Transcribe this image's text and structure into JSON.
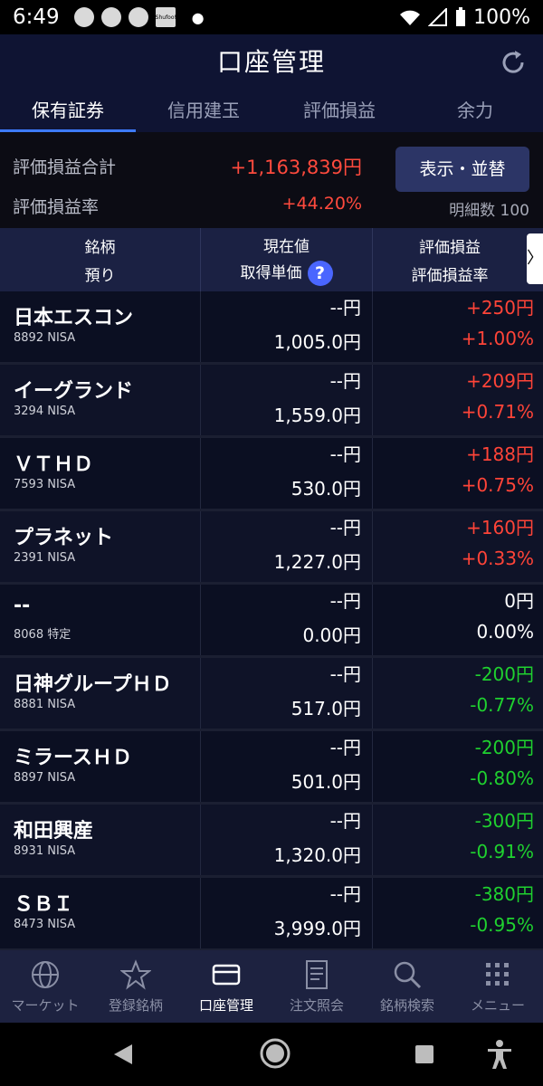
{
  "status": {
    "time": "6:49",
    "battery": "100%",
    "notif_box_text": "Shufoo!"
  },
  "header": {
    "title": "口座管理"
  },
  "tabs": [
    "保有証券",
    "信用建玉",
    "評価損益",
    "余力"
  ],
  "summary": {
    "total_label": "評価損益合計",
    "total_value": "+1,163,839円",
    "rate_label": "評価損益率",
    "rate_value": "+44.20%",
    "display_button": "表示・並替",
    "detail_count": "明細数 100"
  },
  "table_header": {
    "col1_top": "銘柄",
    "col1_bottom": "預り",
    "col2_top": "現在値",
    "col2_bottom": "取得単価",
    "col3_top": "評価損益",
    "col3_bottom": "評価損益率",
    "help": "?",
    "arrow": "〉"
  },
  "rows": [
    {
      "name": "日本エスコン",
      "code": "8892 NISA",
      "current": "--円",
      "cost": "1,005.0円",
      "pl": "+250円",
      "rate": "+1.00%",
      "sign": "pos"
    },
    {
      "name": "イーグランド",
      "code": "3294 NISA",
      "current": "--円",
      "cost": "1,559.0円",
      "pl": "+209円",
      "rate": "+0.71%",
      "sign": "pos"
    },
    {
      "name": "ＶＴＨＤ",
      "code": "7593 NISA",
      "current": "--円",
      "cost": "530.0円",
      "pl": "+188円",
      "rate": "+0.75%",
      "sign": "pos"
    },
    {
      "name": "プラネット",
      "code": "2391 NISA",
      "current": "--円",
      "cost": "1,227.0円",
      "pl": "+160円",
      "rate": "+0.33%",
      "sign": "pos"
    },
    {
      "name": "--",
      "code": "8068 特定",
      "current": "--円",
      "cost": "0.00円",
      "pl": "0円",
      "rate": "0.00%",
      "sign": "neu"
    },
    {
      "name": "日神グループＨＤ",
      "code": "8881 NISA",
      "current": "--円",
      "cost": "517.0円",
      "pl": "-200円",
      "rate": "-0.77%",
      "sign": "neg"
    },
    {
      "name": "ミラースＨＤ",
      "code": "8897 NISA",
      "current": "--円",
      "cost": "501.0円",
      "pl": "-200円",
      "rate": "-0.80%",
      "sign": "neg"
    },
    {
      "name": "和田興産",
      "code": "8931 NISA",
      "current": "--円",
      "cost": "1,320.0円",
      "pl": "-300円",
      "rate": "-0.91%",
      "sign": "neg"
    },
    {
      "name": "ＳＢＩ",
      "code": "8473 NISA",
      "current": "--円",
      "cost": "3,999.0円",
      "pl": "-380円",
      "rate": "-0.95%",
      "sign": "neg"
    }
  ],
  "bottom_nav": [
    {
      "label": "マーケット",
      "icon": "globe-icon"
    },
    {
      "label": "登録銘柄",
      "icon": "star-icon"
    },
    {
      "label": "口座管理",
      "icon": "card-icon",
      "active": true
    },
    {
      "label": "注文照会",
      "icon": "document-icon"
    },
    {
      "label": "銘柄検索",
      "icon": "search-icon"
    },
    {
      "label": "メニュー",
      "icon": "grid-icon"
    }
  ],
  "colors": {
    "positive": "#ff4438",
    "negative": "#1fd12f",
    "accent": "#3d7bff",
    "button": "#2c3566"
  }
}
